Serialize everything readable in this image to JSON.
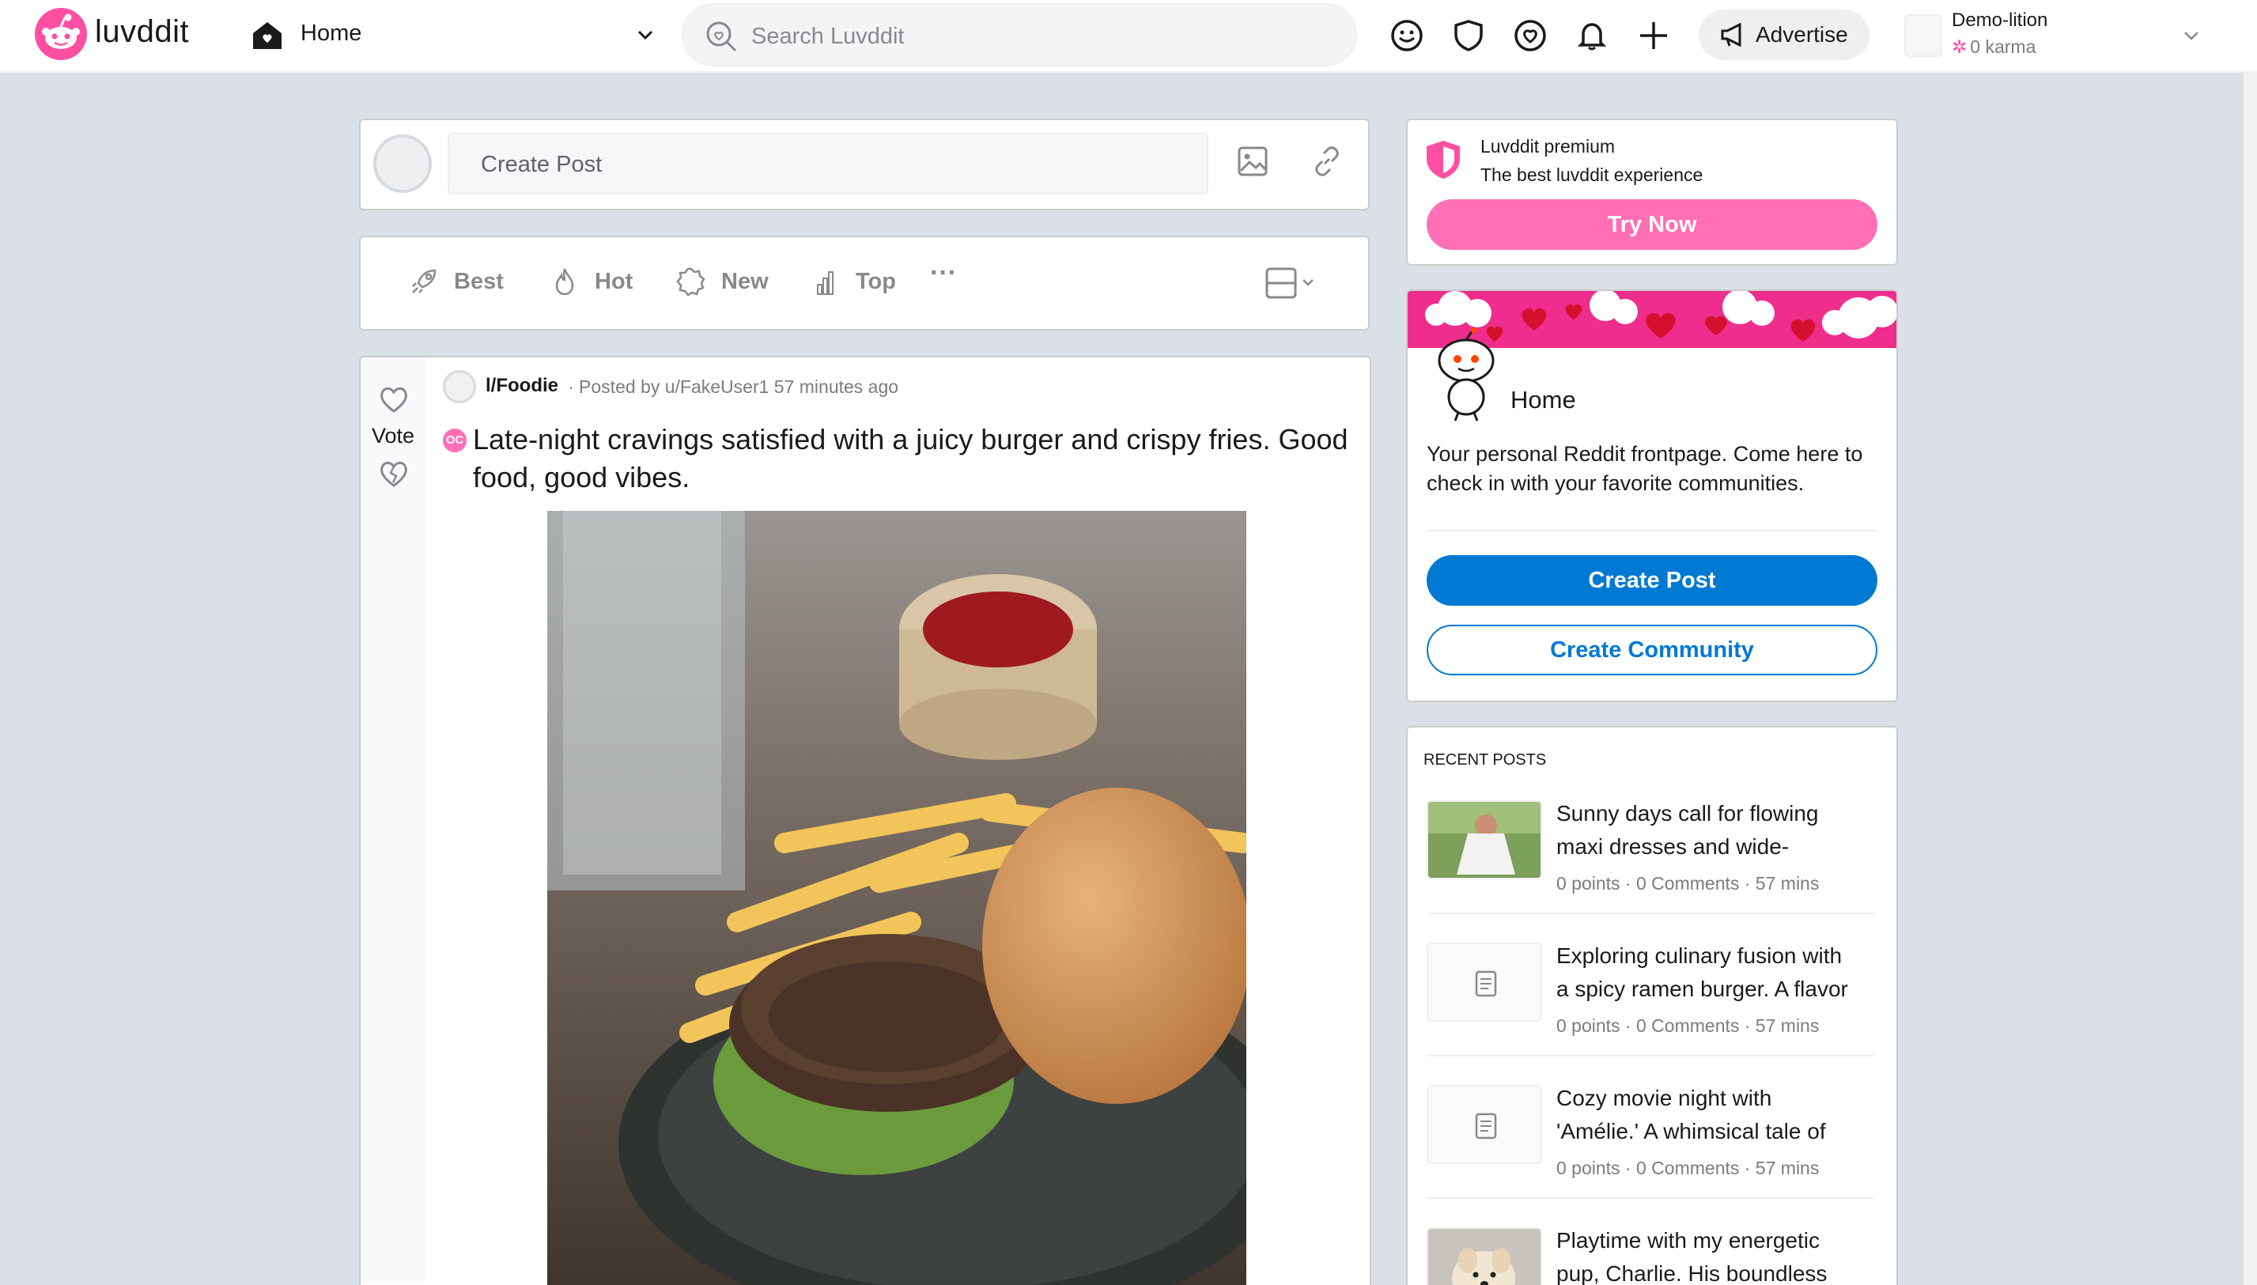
{
  "header": {
    "logo_text": "luvddit",
    "home_label": "Home",
    "search_placeholder": "Search Luvddit",
    "advertise_label": "Advertise",
    "user_name": "Demo-lition",
    "user_karma": "0 karma"
  },
  "create_post_bar": {
    "placeholder": "Create Post"
  },
  "sort_bar": {
    "items": [
      {
        "label": "Best",
        "icon": "rocket-icon"
      },
      {
        "label": "Hot",
        "icon": "flame-icon"
      },
      {
        "label": "New",
        "icon": "badge-icon"
      },
      {
        "label": "Top",
        "icon": "bar-chart-icon"
      }
    ],
    "more_label": "···"
  },
  "post": {
    "vote_label": "Vote",
    "subreddit": "l/Foodie",
    "meta": "· Posted by u/FakeUser1 57 minutes ago",
    "badge": "OC",
    "title": "Late-night cravings satisfied with a juicy burger and crispy fries. Good food, good vibes."
  },
  "premium": {
    "title": "Luvddit premium",
    "subtitle": "The best luvddit experience",
    "button": "Try Now"
  },
  "home_card": {
    "title": "Home",
    "description": "Your personal Reddit frontpage. Come here to check in with your favorite communities.",
    "create_post_button": "Create Post",
    "create_community_button": "Create Community"
  },
  "recent_posts": {
    "heading": "RECENT POSTS",
    "items": [
      {
        "title_line1": "Sunny days call for flowing",
        "title_line2": "maxi dresses and wide-",
        "meta": "0 points · 0 Comments · 57 mins",
        "thumb": "photo"
      },
      {
        "title_line1": "Exploring culinary fusion with",
        "title_line2": "a spicy ramen burger. A flavor",
        "meta": "0 points · 0 Comments · 57 mins",
        "thumb": "text"
      },
      {
        "title_line1": "Cozy movie night with",
        "title_line2": "'Amélie.' A whimsical tale of",
        "meta": "0 points · 0 Comments · 57 mins",
        "thumb": "text"
      },
      {
        "title_line1": "Playtime with my energetic",
        "title_line2": "pup, Charlie. His boundless",
        "meta": "",
        "thumb": "photo"
      }
    ]
  },
  "colors": {
    "brand_pink": "#ff4fa3",
    "primary_blue": "#0079d3",
    "background": "#dae0e6"
  }
}
